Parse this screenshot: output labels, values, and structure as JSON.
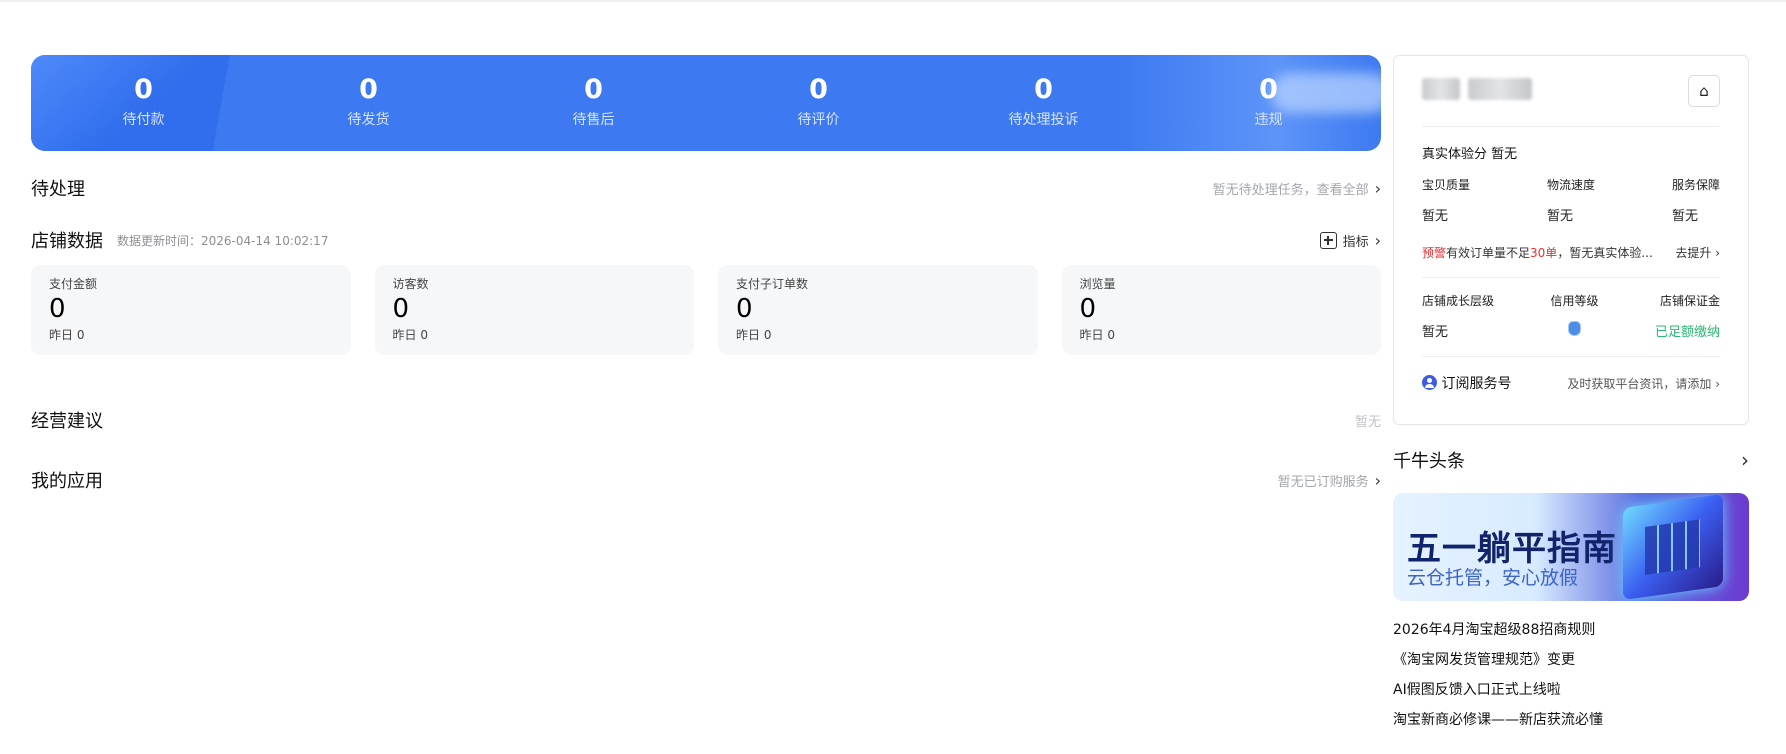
{
  "stats": [
    {
      "value": "0",
      "label": "待付款"
    },
    {
      "value": "0",
      "label": "待发货"
    },
    {
      "value": "0",
      "label": "待售后"
    },
    {
      "value": "0",
      "label": "待评价"
    },
    {
      "value": "0",
      "label": "待处理投诉"
    },
    {
      "value": "0",
      "label": "违规"
    }
  ],
  "pending": {
    "title": "待处理",
    "link": "暂无待处理任务，查看全部"
  },
  "shop_data": {
    "title": "店铺数据",
    "update": "数据更新时间：2026-04-14 10:02:17",
    "metric_btn": "指标",
    "cards": [
      {
        "label": "支付金额",
        "value": "0",
        "prev": "昨日 0"
      },
      {
        "label": "访客数",
        "value": "0",
        "prev": "昨日 0"
      },
      {
        "label": "支付子订单数",
        "value": "0",
        "prev": "昨日 0"
      },
      {
        "label": "浏览量",
        "value": "0",
        "prev": "昨日 0"
      }
    ]
  },
  "advice": {
    "title": "经营建议",
    "right": "暂无"
  },
  "apps": {
    "title": "我的应用",
    "link": "暂无已订购服务"
  },
  "shop_panel": {
    "experience": "真实体验分  暂无",
    "metrics": [
      {
        "label": "宝贝质量",
        "value": "暂无"
      },
      {
        "label": "物流速度",
        "value": "暂无"
      },
      {
        "label": "服务保障",
        "value": "暂无"
      }
    ],
    "warn_tag": "预警",
    "warn_pre": "有效订单量不足",
    "warn_num": "30单",
    "warn_post": "，暂无真实体验...",
    "warn_link": "去提升",
    "levels": [
      {
        "label": "店铺成长层级",
        "value": "暂无"
      },
      {
        "label": "信用等级",
        "value": ""
      },
      {
        "label": "店铺保证金",
        "value": "已足额缴纳"
      }
    ],
    "subscribe": "订阅服务号",
    "subscribe_hint": "及时获取平台资讯，请添加"
  },
  "news": {
    "title": "千牛头条",
    "ad_title": "五一躺平指南",
    "ad_sub": "云仓托管，安心放假",
    "items": [
      "2026年4月淘宝超级88招商规则",
      "《淘宝网发货管理规范》变更",
      "AI假图反馈入口正式上线啦",
      "淘宝新商必修课——新店获流必懂"
    ]
  }
}
